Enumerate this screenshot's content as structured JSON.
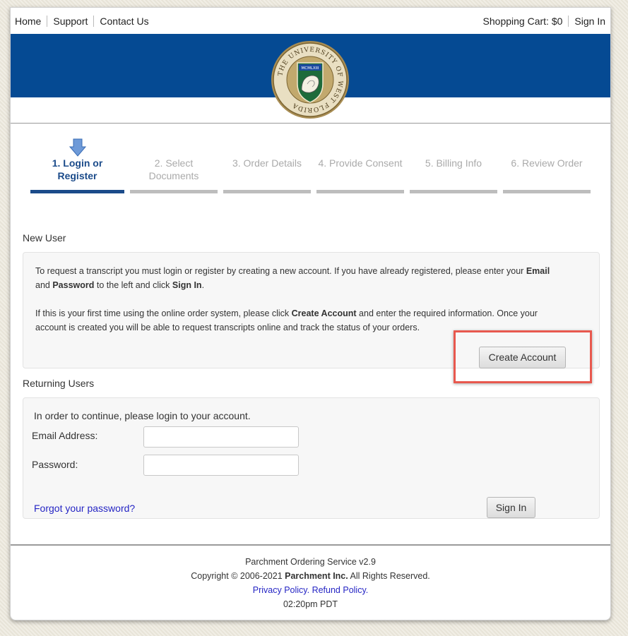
{
  "nav": {
    "home": "Home",
    "support": "Support",
    "contact": "Contact Us",
    "cart": "Shopping Cart: $0",
    "sign_in": "Sign In"
  },
  "banner": {
    "accent_color": "#054a93",
    "seal_text": "THE UNIVERSITY OF WEST FLORIDA",
    "seal_year": "MCMLXIII"
  },
  "steps": [
    {
      "line1": "1. Login or",
      "line2": "Register",
      "active": true
    },
    {
      "line1": "2. Select",
      "line2": "Documents",
      "active": false
    },
    {
      "line1": "3. Order Details",
      "line2": "",
      "active": false
    },
    {
      "line1": "4. Provide Consent",
      "line2": "",
      "active": false
    },
    {
      "line1": "5. Billing Info",
      "line2": "",
      "active": false
    },
    {
      "line1": "6. Review Order",
      "line2": "",
      "active": false
    }
  ],
  "new_user": {
    "title": "New User",
    "p1_a": "To request a transcript you must login or register by creating a new account. If you have already registered, please enter your ",
    "p1_email": "Email",
    "p1_b": "and ",
    "p1_password": "Password",
    "p1_c": " to the left and click ",
    "p1_signin": "Sign In",
    "p1_d": ".",
    "p2_a": "If this is your first time using the online order system, please click ",
    "p2_create": "Create Account",
    "p2_b": " and enter the required information. Once your",
    "p2_c": "account is created you will be able to request transcripts online and track the status of your orders.",
    "create_button": "Create Account"
  },
  "returning": {
    "title": "Returning Users",
    "intro": "In order to continue, please login to your account.",
    "email_label": "Email Address:",
    "password_label": "Password:",
    "email_value": "",
    "password_value": "",
    "forgot_link": "Forgot your password?",
    "sign_in_button": "Sign In"
  },
  "footer": {
    "service": "Parchment Ordering Service v2.9",
    "copyright_a": "Copyright © 2006-2021 ",
    "company": "Parchment Inc.",
    "copyright_b": " All Rights Reserved.",
    "privacy": "Privacy Policy.",
    "refund": "Refund Policy.",
    "time": "02:20pm PDT"
  }
}
